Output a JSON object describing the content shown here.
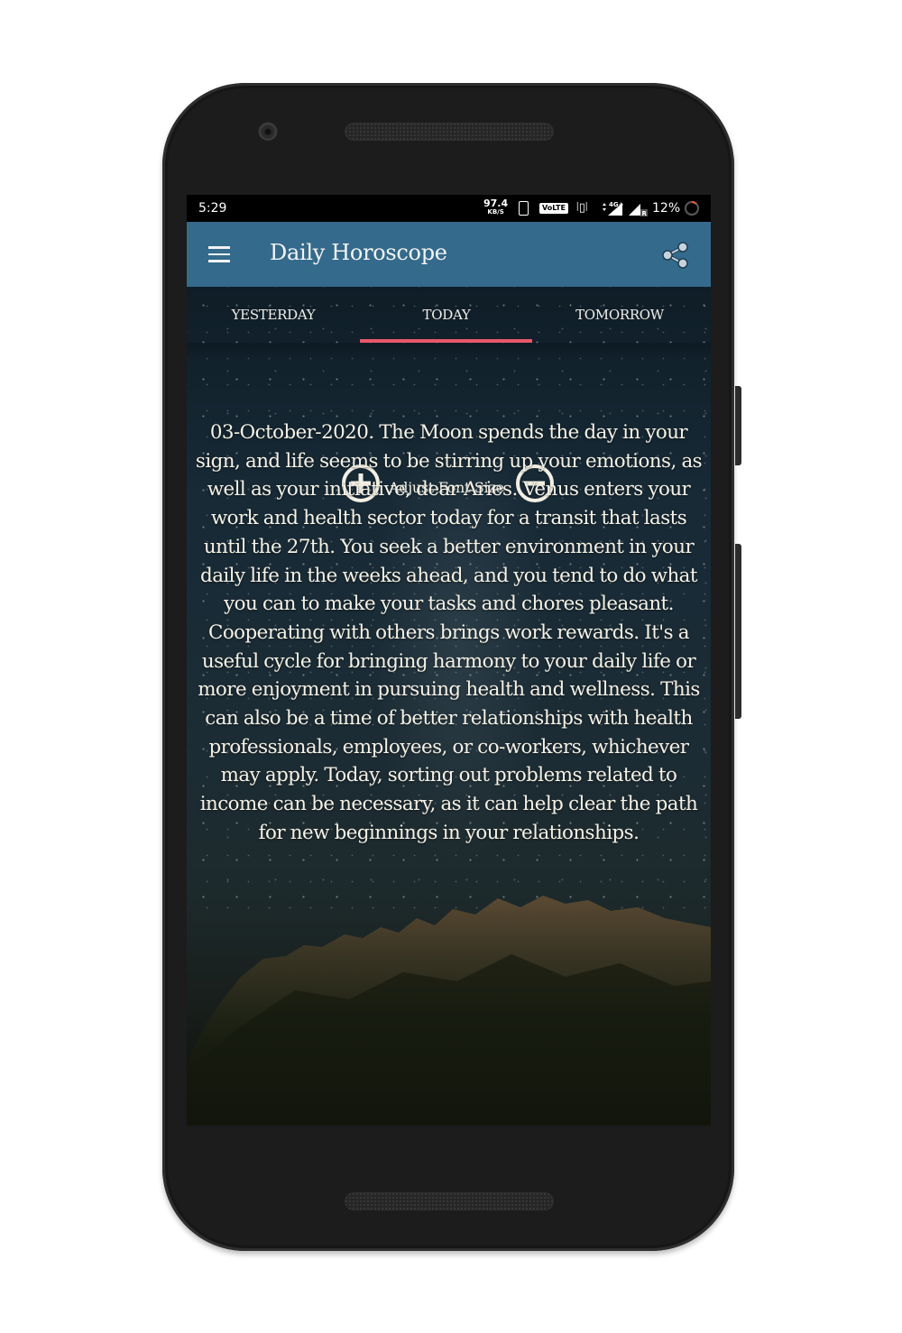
{
  "status_bar": {
    "time": "5:29",
    "network_speed_value": "97.4",
    "network_speed_unit": "KB/S",
    "volte_label": "VoLTE",
    "data_type": "4G+",
    "roaming_indicator": "R",
    "battery_percent_text": "12%",
    "battery_level": 0.12,
    "battery_color": "#e8572f"
  },
  "app_bar": {
    "title": "Daily Horoscope",
    "background_color": "#346a8c",
    "menu_icon": "hamburger-menu-icon",
    "share_icon": "share-icon"
  },
  "tabs": {
    "items": [
      {
        "label": "YESTERDAY",
        "selected": false
      },
      {
        "label": "TODAY",
        "selected": true
      },
      {
        "label": "TOMORROW",
        "selected": false
      }
    ],
    "indicator_color": "#e8576b"
  },
  "font_controls": {
    "label": "Adjust Font Size",
    "increase_icon": "plus-circle-icon",
    "decrease_icon": "minus-circle-icon"
  },
  "horoscope": {
    "sign": "Aries",
    "date": "03-October-2020",
    "text": "03-October-2020. The Moon spends the day in your sign, and life seems to be stirring up your emotions, as well as your initiative, dear Aries. Venus enters your work and health sector today for a transit that lasts until the 27th. You seek a better environment in your daily life in the weeks ahead, and you tend to do what you can to make your tasks and chores pleasant. Cooperating with others brings work rewards. It's a useful cycle for bringing harmony to your daily life or more enjoyment in pursuing health and wellness. This can also be a time of better relationships with health professionals, employees, or co-workers, whichever may apply. Today, sorting out problems related to income can be necessary, as it can help clear the path for new beginnings in your relationships."
  }
}
